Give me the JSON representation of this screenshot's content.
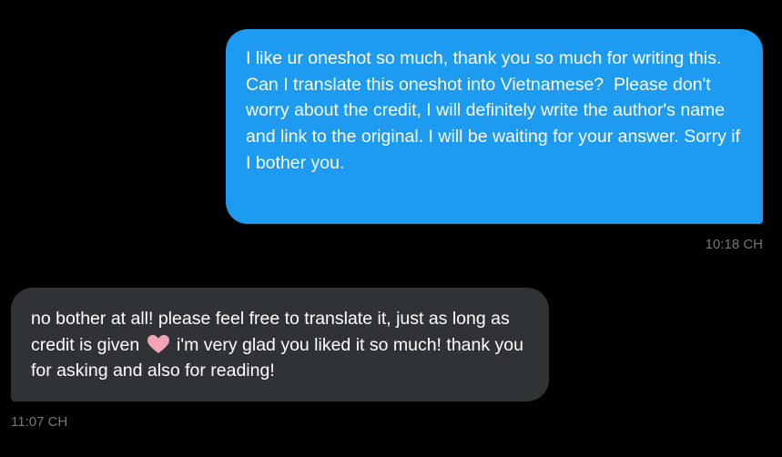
{
  "messages": [
    {
      "direction": "outgoing",
      "text": "I like ur oneshot so much, thank you so much for writing this. Can I translate this oneshot into Vietnamese?  Please don't worry about the credit, I will definitely write the author's name and link to the original. I will be waiting for your answer. Sorry if I bother you.",
      "time": "10:18 CH"
    },
    {
      "direction": "incoming",
      "text_before_emoji": "no bother at all! please feel free to translate it, just as long as credit is given ",
      "emoji": "pink-heart-icon",
      "text_after_emoji": " i'm very glad you liked it so much! thank you for asking and also for reading!",
      "time": "11:07 CH"
    }
  ],
  "colors": {
    "background": "#000000",
    "outgoing_bubble": "#1d9bf0",
    "incoming_bubble": "#2f3336",
    "timestamp": "#71767b",
    "heart": "#f4a4b4"
  }
}
